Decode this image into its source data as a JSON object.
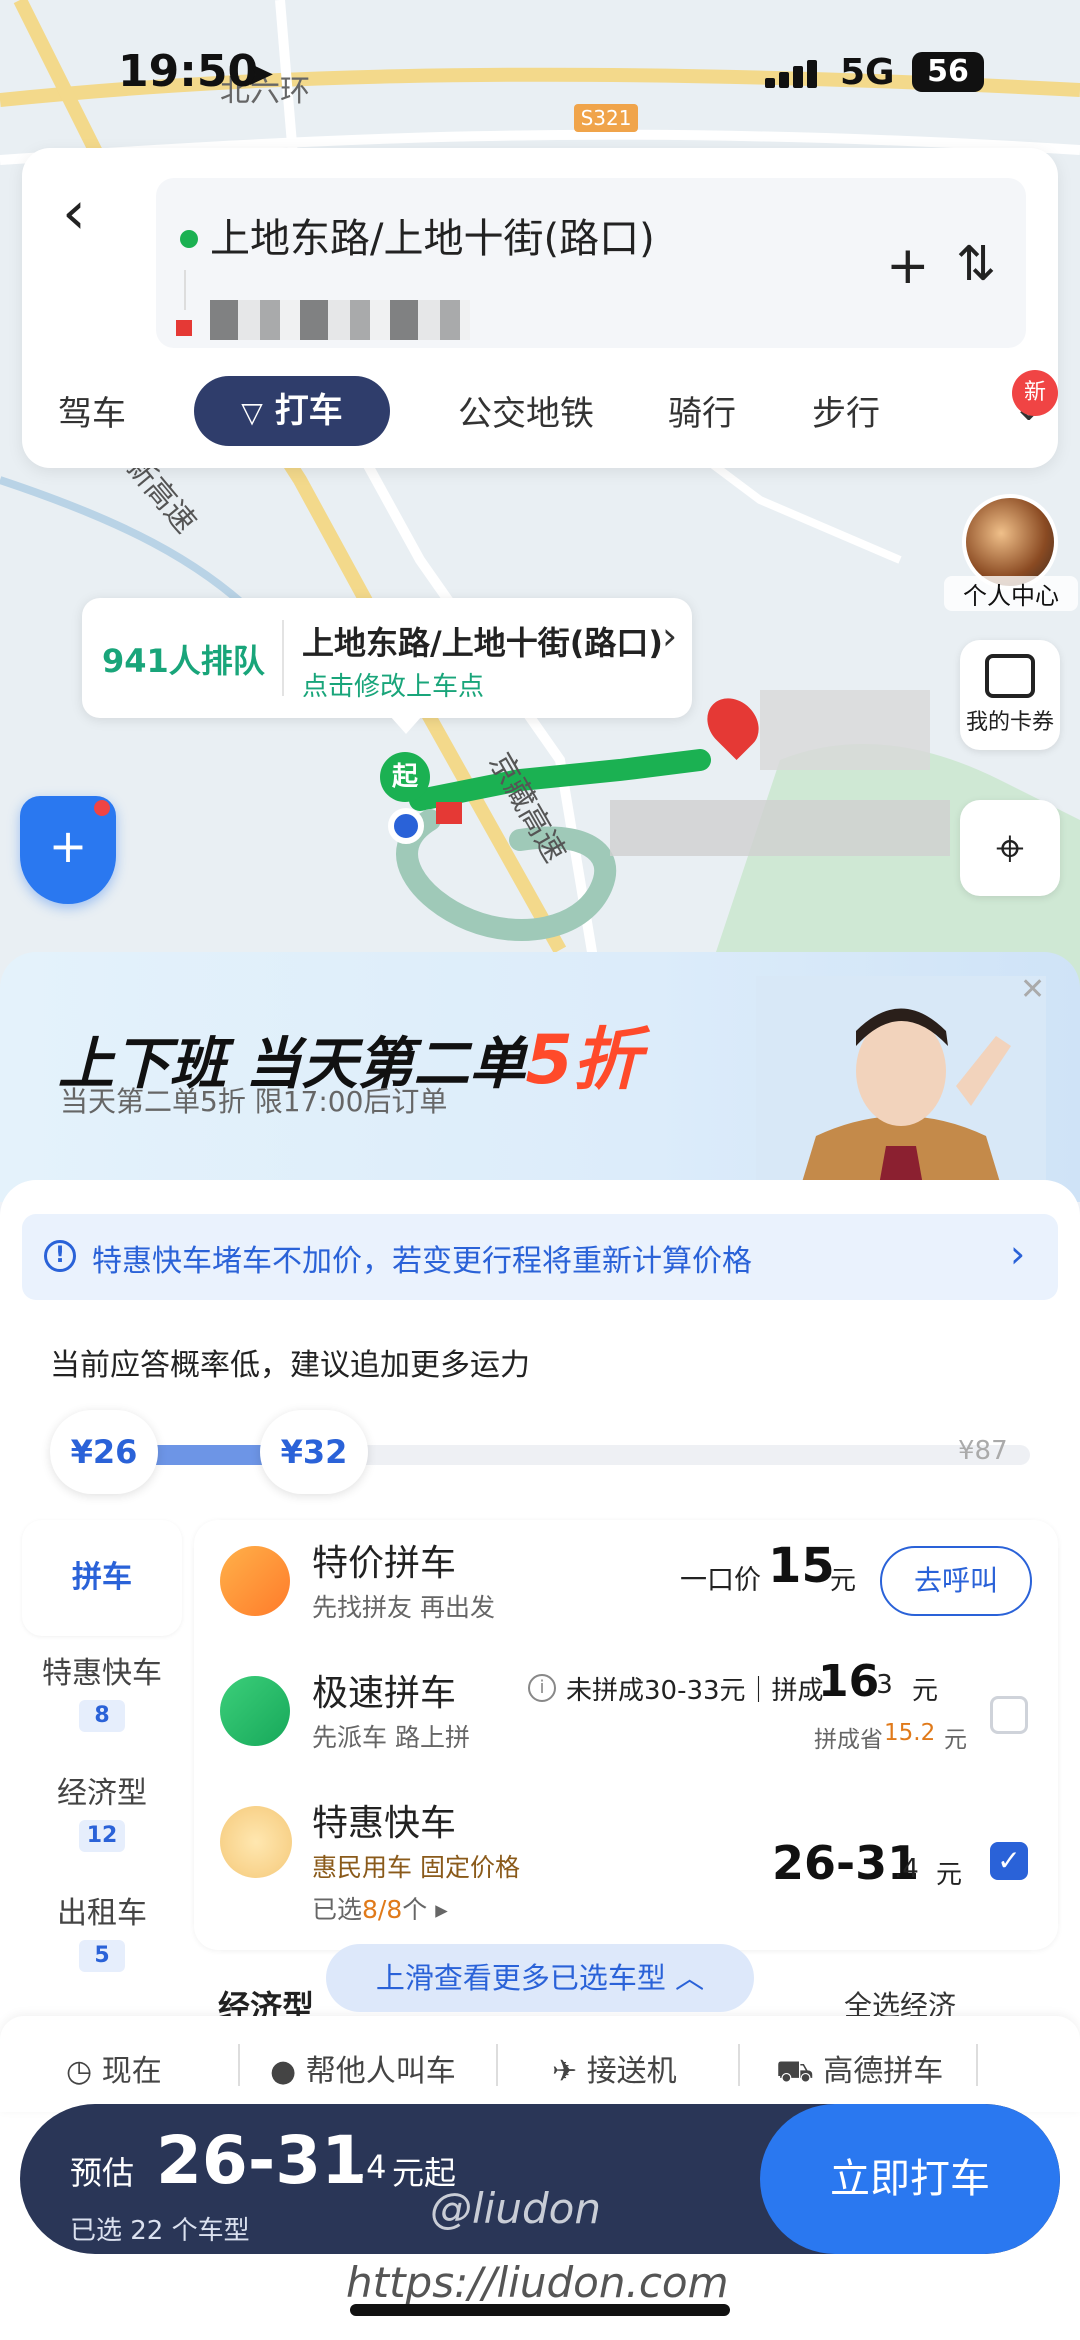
{
  "status": {
    "time": "19:50",
    "network": "5G",
    "battery": "56"
  },
  "map": {
    "road_north": "北六环",
    "road_s321": "S321",
    "road_xinggao": "新高速",
    "road_jingzang": "京藏高速",
    "start_marker": "起"
  },
  "topcard": {
    "from": "上地东路/上地十街(路口)",
    "plus": "+",
    "swap": "⇅",
    "modes": [
      "驾车",
      "打车",
      "公交地铁",
      "骑行",
      "步行"
    ],
    "new_badge": "新"
  },
  "side": {
    "profile": "个人中心",
    "coupon": "我的卡券"
  },
  "popup": {
    "queue": "941人排队",
    "address": "上地东路/上地十街(路口)",
    "hint": "点击修改上车点"
  },
  "promo": {
    "title_prefix": "上下班 当天第二单",
    "title_highlight": "5折",
    "subtitle": "当天第二单5折 限17:00后订单"
  },
  "notice": {
    "text": "特惠快车堵车不加价，若变更行程将重新计算价格"
  },
  "lowrate": "当前应答概率低，建议追加更多运力",
  "slider": {
    "low": "¥26",
    "mid": "¥32",
    "max": "¥87"
  },
  "leftnav": [
    {
      "label": "拼车",
      "count": ""
    },
    {
      "label": "特惠快车",
      "count": "8"
    },
    {
      "label": "经济型",
      "count": "12"
    },
    {
      "label": "出租车",
      "count": "5"
    }
  ],
  "rows": [
    {
      "name": "特价拼车",
      "sub": "先找拼友 再出发",
      "price_prefix": "一口价",
      "price": "15",
      "unit": "元",
      "button": "去呼叫"
    },
    {
      "name": "极速拼车",
      "sub": "先派车 路上拼",
      "price_text": "未拼成30-33元｜拼成",
      "price": "16",
      "price_dec": ".3",
      "unit": "元",
      "save_prefix": "拼成省",
      "save_val": "15.2",
      "save_unit": "元"
    },
    {
      "name": "特惠快车",
      "sub": "惠民用车 固定价格",
      "selected_prefix": "已选",
      "selected_val": "8/8",
      "selected_suffix": "个",
      "price": "26-31",
      "price_dec": ".4",
      "unit": "元"
    }
  ],
  "partial_row": {
    "name": "经济型",
    "right": "全选经济"
  },
  "scroll_hint": "上滑查看更多已选车型",
  "options": [
    "现在",
    "帮他人叫车",
    "接送机",
    "高德拼车"
  ],
  "bottom": {
    "est_label": "预估",
    "est_value": "26-31",
    "est_dec": ".4",
    "est_unit": "元起",
    "selected": "已选 22 个车型",
    "cta": "立即打车"
  },
  "watermark": {
    "handle": "@liudon",
    "url": "https://liudon.com"
  },
  "colors": {
    "brand_blue": "#2a62d8",
    "navy": "#2a3657",
    "green": "#19a57a",
    "promo_red": "#ff4a2a"
  }
}
